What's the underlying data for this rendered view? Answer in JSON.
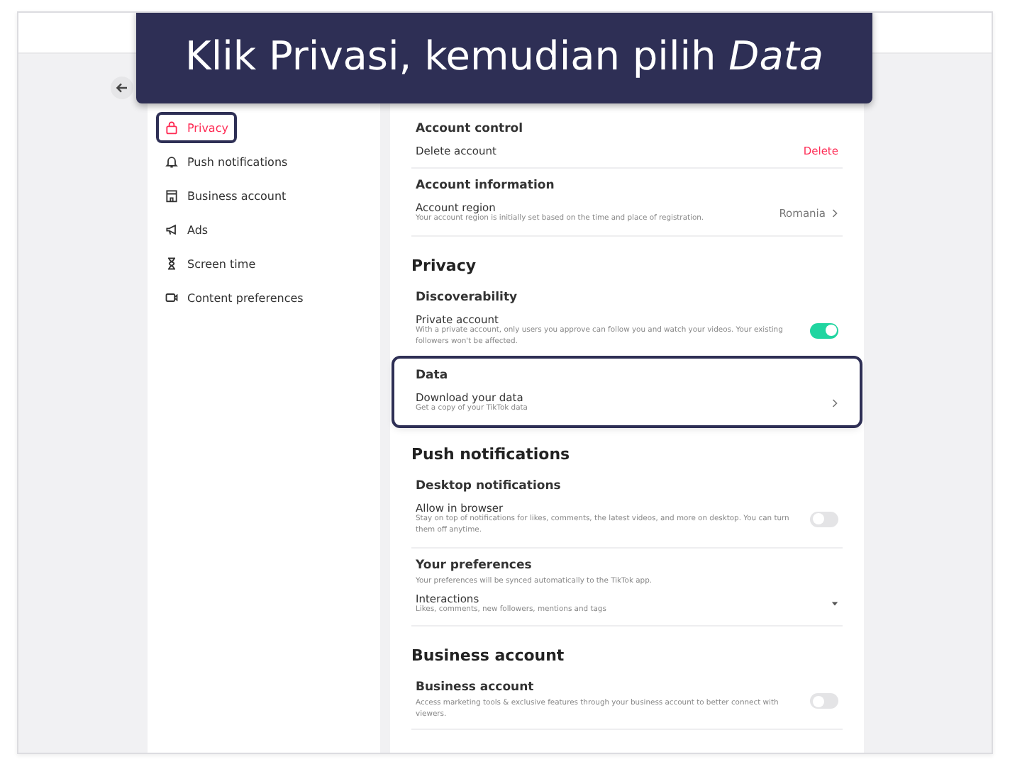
{
  "callout": "Klik Privasi, kemudian pilih *Data*",
  "sidebar": {
    "items": [
      {
        "label": "Privacy",
        "selected": true,
        "highlighted": true
      },
      {
        "label": "Push notifications",
        "selected": false,
        "highlighted": false
      },
      {
        "label": "Business account",
        "selected": false,
        "highlighted": false
      },
      {
        "label": "Ads",
        "selected": false,
        "highlighted": false
      },
      {
        "label": "Screen time",
        "selected": false,
        "highlighted": false
      },
      {
        "label": "Content preferences",
        "selected": false,
        "highlighted": false
      }
    ]
  },
  "sections": [
    {
      "groups": [
        {
          "title": "Account control",
          "highlighted": false,
          "rows": [
            {
              "kind": "action",
              "label": "Delete account",
              "value": "Delete"
            }
          ]
        },
        {
          "title": "Account information",
          "highlighted": false,
          "rows": [
            {
              "kind": "link",
              "label": "Account region",
              "description": "Your account region is initially set based on the time and place of registration.",
              "value": "Romania"
            }
          ]
        }
      ]
    },
    {
      "title": "Privacy",
      "groups": [
        {
          "title": "Discoverability",
          "highlighted": false,
          "rows": [
            {
              "kind": "toggle",
              "label": "Private account",
              "description": "With a private account, only users you approve can follow you and watch your videos. Your existing followers won't be affected.",
              "on": true
            }
          ]
        },
        {
          "title": "Data",
          "highlighted": true,
          "rows": [
            {
              "kind": "link",
              "label": "Download your data",
              "description": "Get a copy of your TikTok data"
            }
          ]
        }
      ]
    },
    {
      "title": "Push notifications",
      "groups": [
        {
          "title": "Desktop notifications",
          "highlighted": false,
          "rows": [
            {
              "kind": "toggle",
              "label": "Allow in browser",
              "description": "Stay on top of notifications for likes, comments, the latest videos, and more on desktop. You can turn them off anytime.",
              "on": false
            }
          ]
        },
        {
          "title": "Your preferences",
          "description": "Your preferences will be synced automatically to the TikTok app.",
          "highlighted": false,
          "rows": [
            {
              "kind": "dropdown",
              "label": "Interactions",
              "description": "Likes, comments, new followers, mentions and tags"
            }
          ]
        }
      ]
    },
    {
      "title": "Business account",
      "groups": [
        {
          "title": "Business account",
          "description": "Access marketing tools & exclusive features through your business account to better connect with viewers.",
          "highlighted": false,
          "toggle": false
        }
      ]
    }
  ]
}
